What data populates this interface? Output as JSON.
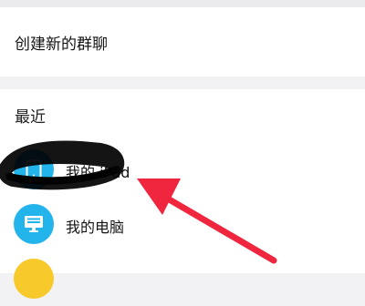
{
  "create_group": {
    "label": "创建新的群聊"
  },
  "recent": {
    "label": "最近"
  },
  "devices": [
    {
      "label": "我的 iPad",
      "icon": "tablet-icon"
    },
    {
      "label": "我的电脑",
      "icon": "monitor-icon"
    },
    {
      "label": "",
      "icon": "device-icon"
    }
  ],
  "colors": {
    "accent_blue": "#23b4ec",
    "accent_yellow": "#f8c92b",
    "annotation_red": "#f0263f"
  }
}
